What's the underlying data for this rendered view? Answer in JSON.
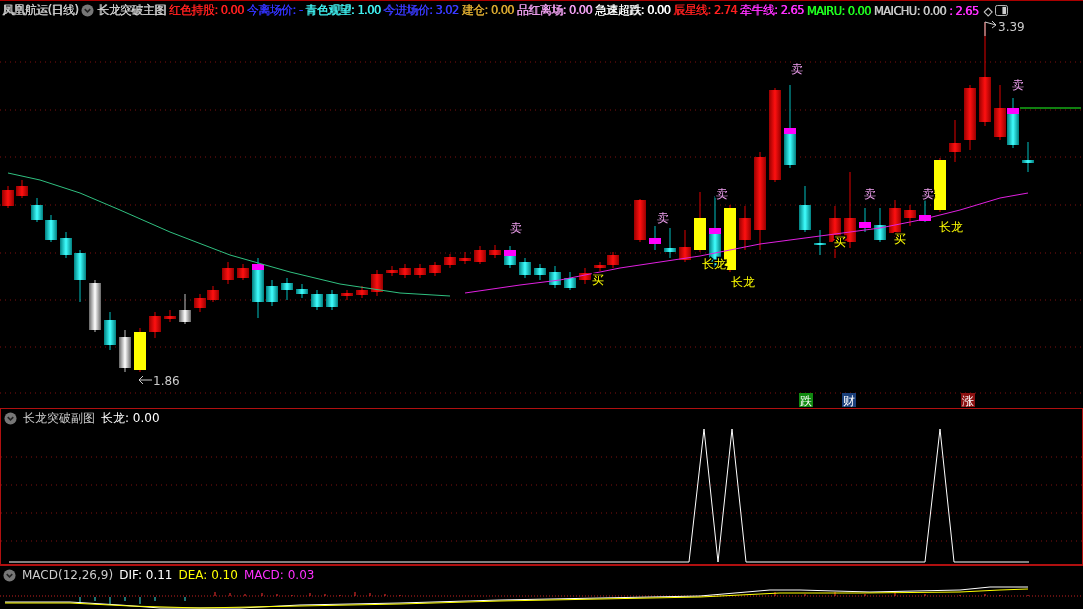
{
  "title_bar": {
    "stock": "凤凰航运(日线)",
    "indicator": "长龙突破主图",
    "readouts": [
      {
        "text": "红色持股: 0.00",
        "color": "#ff2020"
      },
      {
        "text": "今离场价: -",
        "color": "#3333ff"
      },
      {
        "text": "青色观望: 1.00",
        "color": "#40f0f0"
      },
      {
        "text": "今进场价: 3.02",
        "color": "#3a3aff"
      },
      {
        "text": "建仓: 0.00",
        "color": "#d8a830"
      },
      {
        "text": "品红离场: 0.00",
        "color": "#f0a0f0"
      },
      {
        "text": "急速超跌: 0.00",
        "color": "#ffffff"
      },
      {
        "text": "辰星线: 2.74",
        "color": "#ff2020"
      },
      {
        "text": "牵牛线: 2.65",
        "color": "#ff30ff"
      },
      {
        "text": "MAIRU: 0.00",
        "color": "#20ff20"
      },
      {
        "text": "MAICHU: 0.00",
        "color": "#c8c8c8"
      },
      {
        "text": ": 2.65",
        "color": "#ff30ff"
      }
    ],
    "diamond": "◇"
  },
  "main_chart": {
    "high_label": "3.39",
    "low_label": "1.86",
    "signals": [
      {
        "text": "卖",
        "kind": "sell"
      },
      {
        "text": "买",
        "kind": "buy"
      },
      {
        "text": "卖",
        "kind": "sell"
      },
      {
        "text": "卖",
        "kind": "sell"
      },
      {
        "text": "长龙",
        "kind": "dragon"
      },
      {
        "text": "长龙",
        "kind": "dragon"
      },
      {
        "text": "卖",
        "kind": "sell"
      },
      {
        "text": "买",
        "kind": "buy"
      },
      {
        "text": "卖",
        "kind": "sell"
      },
      {
        "text": "买",
        "kind": "buy"
      },
      {
        "text": "卖",
        "kind": "sell"
      },
      {
        "text": "长龙",
        "kind": "dragon"
      },
      {
        "text": "卖",
        "kind": "sell"
      }
    ],
    "badges": [
      {
        "text": "跌",
        "color": "#108a10"
      },
      {
        "text": "财",
        "color": "#1a3f7a"
      },
      {
        "text": "涨",
        "color": "#8a1010"
      }
    ]
  },
  "sub_chart": {
    "title": "长龙突破副图",
    "readouts": [
      {
        "text": "长龙: 0.00",
        "color": "#ffffff"
      }
    ]
  },
  "macd": {
    "title": "MACD(12,26,9)",
    "readouts": [
      {
        "text": "DIF: 0.11",
        "color": "#ffffff"
      },
      {
        "text": "DEA: 0.10",
        "color": "#ffff00"
      },
      {
        "text": "MACD: 0.03",
        "color": "#ff30ff"
      }
    ]
  }
}
